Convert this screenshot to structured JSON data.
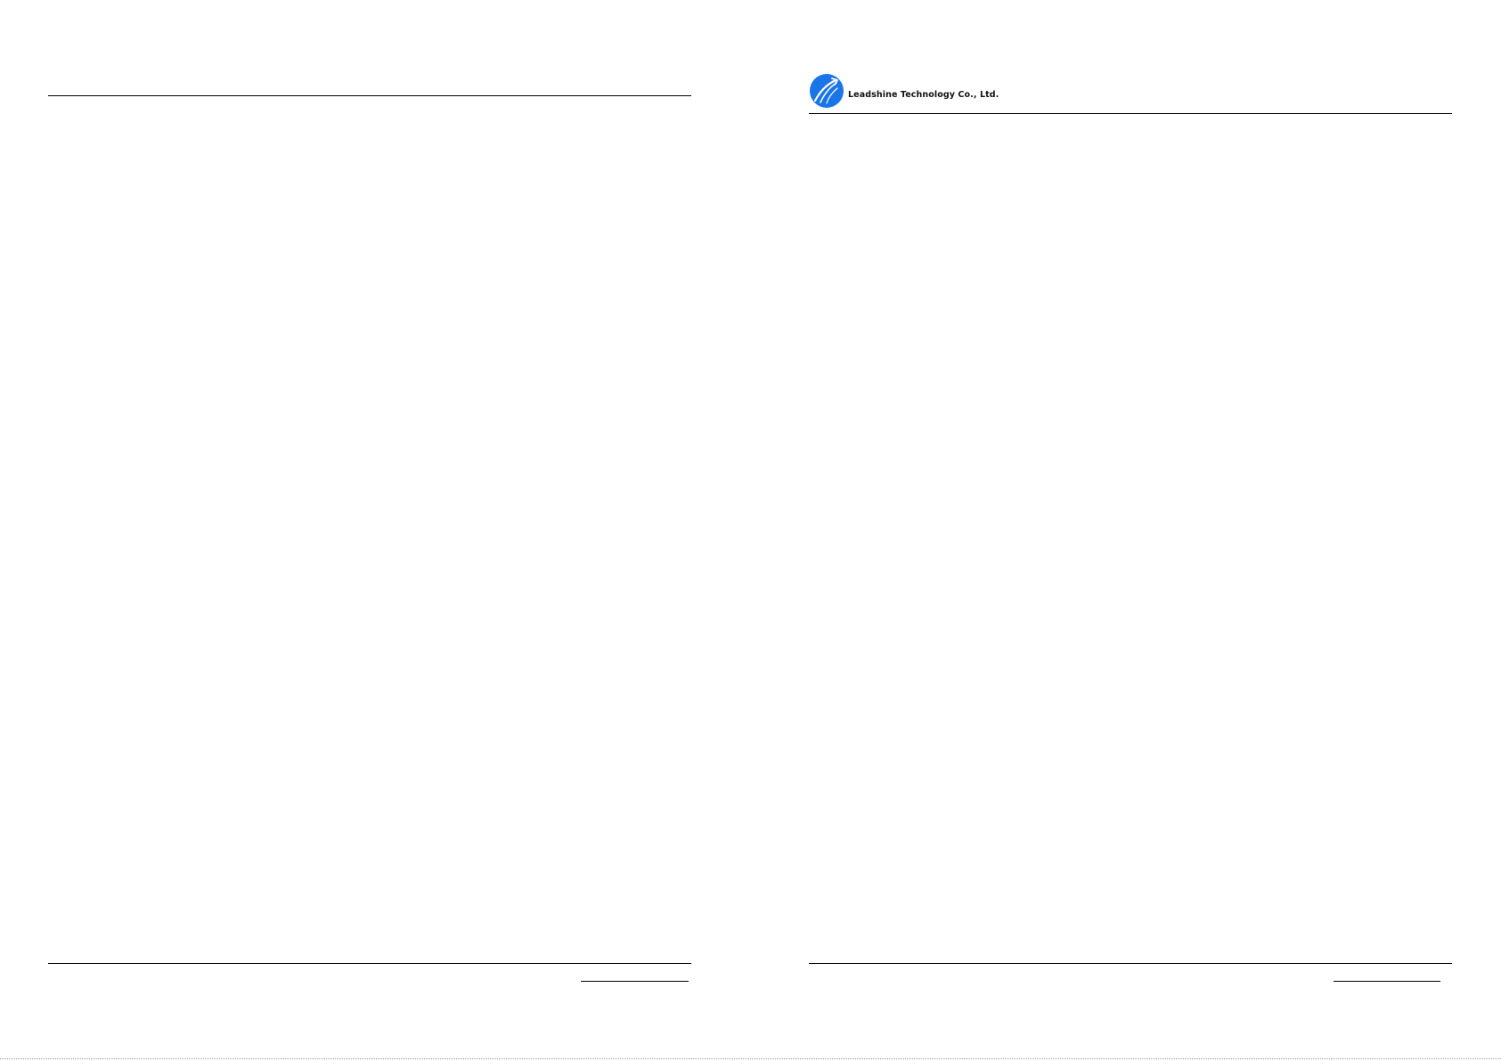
{
  "header": {
    "company_name": "Leadshine Technology Co., Ltd."
  },
  "colors": {
    "logo_blue": "#1a75e6",
    "rule": "#000000"
  },
  "icons": {
    "logo": "leadshine-logo-icon"
  }
}
